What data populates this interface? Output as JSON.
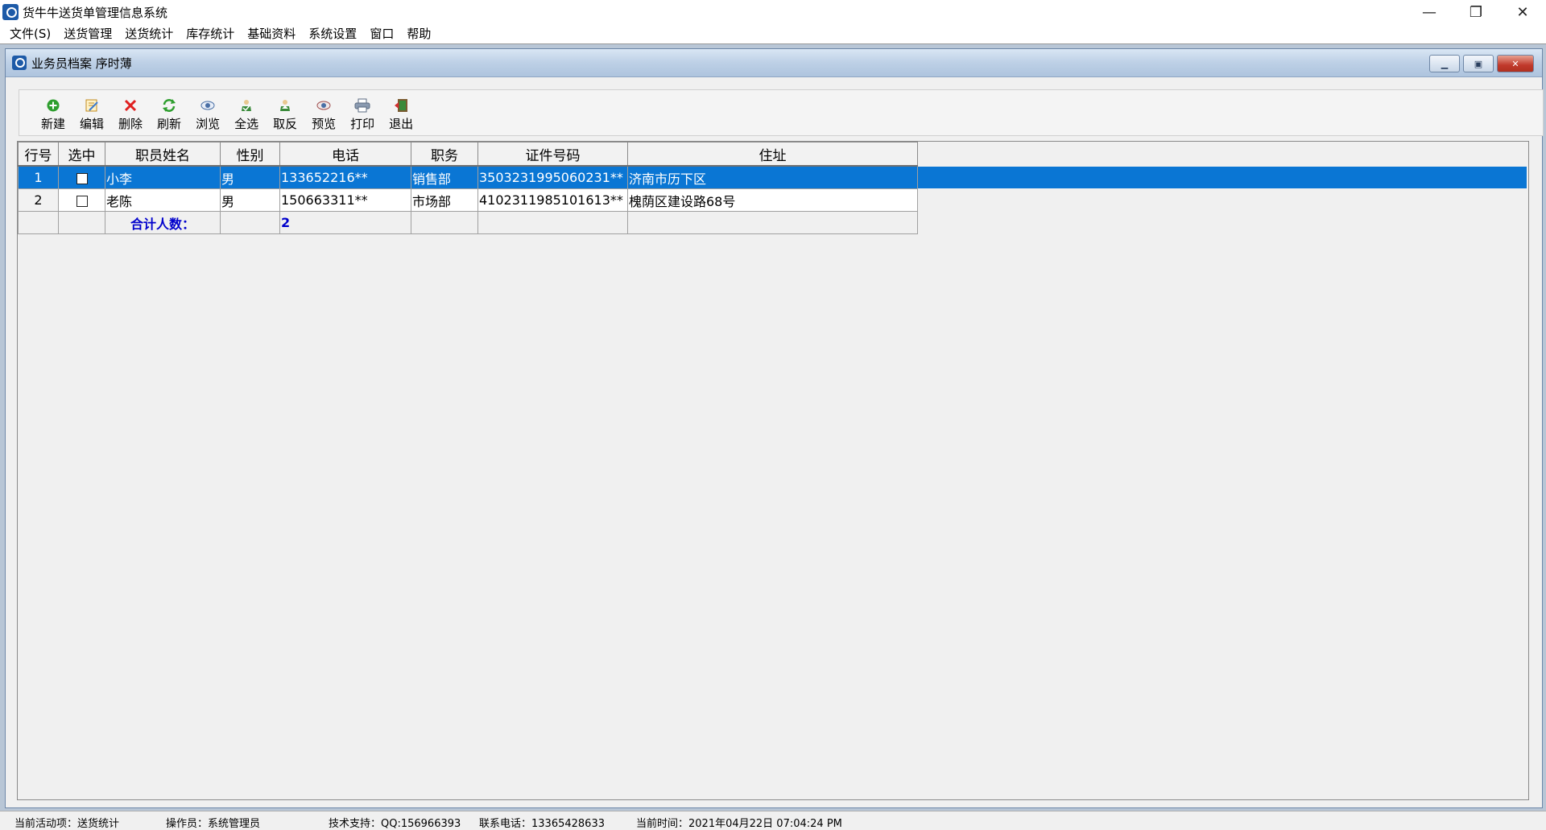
{
  "app": {
    "title": "货牛牛送货单管理信息系统",
    "window_controls": {
      "minimize": "—",
      "restore": "❐",
      "close": "✕"
    }
  },
  "menu": [
    "文件(S)",
    "送货管理",
    "送货统计",
    "库存统计",
    "基础资料",
    "系统设置",
    "窗口",
    "帮助"
  ],
  "child_window": {
    "title": "业务员档案 序时薄",
    "controls": {
      "minimize": "▁",
      "restore": "▣",
      "close": "✕"
    }
  },
  "toolbar": [
    {
      "label": "新建",
      "icon": "add-icon",
      "color": "#2e9e2e"
    },
    {
      "label": "编辑",
      "icon": "edit-icon",
      "color": "#d19a20"
    },
    {
      "label": "删除",
      "icon": "delete-icon",
      "color": "#e02020"
    },
    {
      "label": "刷新",
      "icon": "refresh-icon",
      "color": "#2e9e2e"
    },
    {
      "label": "浏览",
      "icon": "eye-icon",
      "color": "#4a6fa5"
    },
    {
      "label": "全选",
      "icon": "select-all-icon",
      "color": "#3a8a3a"
    },
    {
      "label": "取反",
      "icon": "invert-icon",
      "color": "#3a8a3a"
    },
    {
      "label": "预览",
      "icon": "preview-icon",
      "color": "#4a6fa5"
    },
    {
      "label": "打印",
      "icon": "printer-icon",
      "color": "#5a6a80"
    },
    {
      "label": "退出",
      "icon": "exit-icon",
      "color": "#3a8a3a"
    }
  ],
  "grid": {
    "columns": [
      "行号",
      "选中",
      "职员姓名",
      "性别",
      "电话",
      "职务",
      "证件号码",
      "住址"
    ],
    "rows": [
      {
        "row_no": "1",
        "checked": false,
        "name": "小李",
        "gender": "男",
        "phone": "133652216**",
        "position": "销售部",
        "id_no": "3503231995060231**",
        "address": "济南市历下区"
      },
      {
        "row_no": "2",
        "checked": false,
        "name": "老陈",
        "gender": "男",
        "phone": "150663311**",
        "position": "市场部",
        "id_no": "4102311985101613**",
        "address": "槐荫区建设路68号"
      }
    ],
    "selected_row": 1,
    "total": {
      "label": "合计人数：",
      "value": "2"
    }
  },
  "statusbar": {
    "activity": "当前活动项：送货统计",
    "operator": "操作员：系统管理员",
    "support": "技术支持：QQ:156966393",
    "contact": "联系电话：13365428633",
    "time": "当前时间：2021年04月22日 07:04:24 PM"
  },
  "colors": {
    "selection": "#0a76d4",
    "total_text": "#0000cc",
    "mdi_background": "#b8c6d6"
  }
}
